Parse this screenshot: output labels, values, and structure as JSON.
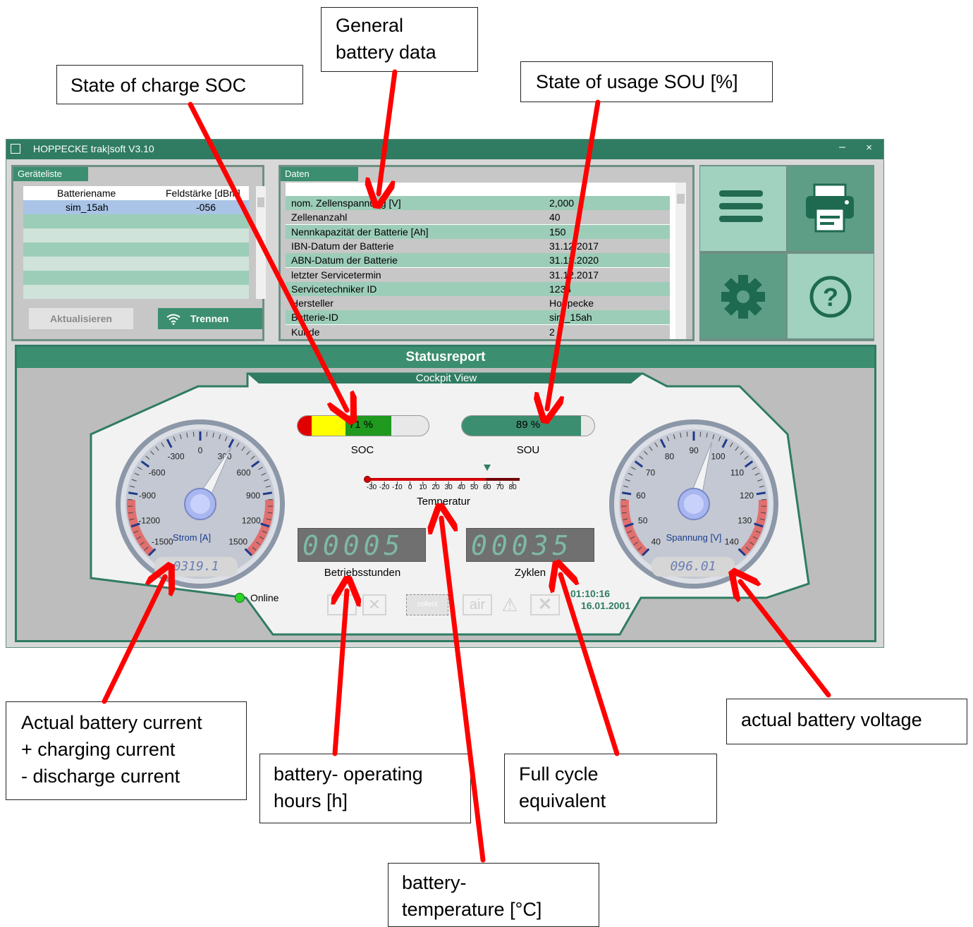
{
  "callouts": {
    "general": [
      "General",
      "battery data"
    ],
    "soc": "State of charge SOC",
    "sou": "State of usage SOU [%]",
    "current": [
      "Actual battery current",
      "+ charging current",
      "- discharge current"
    ],
    "voltage": "actual battery voltage",
    "hours": [
      "battery- operating",
      "hours [h]"
    ],
    "cycles": [
      "Full cycle",
      "equivalent"
    ],
    "temperature": [
      "battery-",
      "temperature [°C]"
    ]
  },
  "window": {
    "title": "HOPPECKE trak|soft V3.10",
    "minimize": "–",
    "close": "×"
  },
  "devices": {
    "tab": "Geräteliste",
    "col1": "Batteriename",
    "col2": "Feldstärke [dBm]",
    "rows": [
      {
        "name": "sim_15ah",
        "strength": "-056"
      }
    ],
    "refresh": "Aktualisieren",
    "disconnect": "Trennen"
  },
  "data": {
    "tab": "Daten",
    "rows": [
      {
        "label": "nom. Zellenspannung [V]",
        "value": "2,000"
      },
      {
        "label": "Zellenanzahl",
        "value": "40"
      },
      {
        "label": "Nennkapazität der Batterie [Ah]",
        "value": "150"
      },
      {
        "label": "IBN-Datum der Batterie",
        "value": "31.12.2017"
      },
      {
        "label": "ABN-Datum der Batterie",
        "value": "31.12.2020"
      },
      {
        "label": "letzter Servicetermin",
        "value": "31.12.2017"
      },
      {
        "label": "Servicetechniker ID",
        "value": "1234"
      },
      {
        "label": "Hersteller",
        "value": "Hoppecke"
      },
      {
        "label": "Batterie-ID",
        "value": "sim_15ah"
      },
      {
        "label": "Kunde",
        "value": "2"
      }
    ]
  },
  "status": {
    "header": "Statusreport",
    "cockpit": "Cockpit View",
    "soc_value": "71 %",
    "soc_label": "SOC",
    "soc_fraction": 0.71,
    "sou_value": "89 %",
    "sou_label": "SOU",
    "sou_fraction": 0.89,
    "temp_label": "Temperatur",
    "temp_ticks": [
      "-30",
      "-20",
      "-10",
      "0",
      "10",
      "20",
      "30",
      "40",
      "50",
      "60",
      "70",
      "80"
    ],
    "hours_display": "00005",
    "hours_label": "Betriebsstunden",
    "cycles_display": "00035",
    "cycles_label": "Zyklen",
    "current_label": "Strom [A]",
    "current_display": "0319.1",
    "current_ticks": [
      "-1500",
      "-1200",
      "-900",
      "-600",
      "-300",
      "0",
      "300",
      "600",
      "900",
      "1200",
      "1500"
    ],
    "voltage_label": "Spannung [V]",
    "voltage_display": "096.01",
    "voltage_ticks": [
      "40",
      "50",
      "60",
      "70",
      "80",
      "90",
      "100",
      "110",
      "120",
      "130",
      "140"
    ],
    "online": "Online",
    "time": "01:10:16",
    "date": "16.01.2001",
    "collect": "collect",
    "air": "air"
  },
  "colors": {
    "accent": "#2f7c63",
    "arrow": "#ff0000"
  }
}
